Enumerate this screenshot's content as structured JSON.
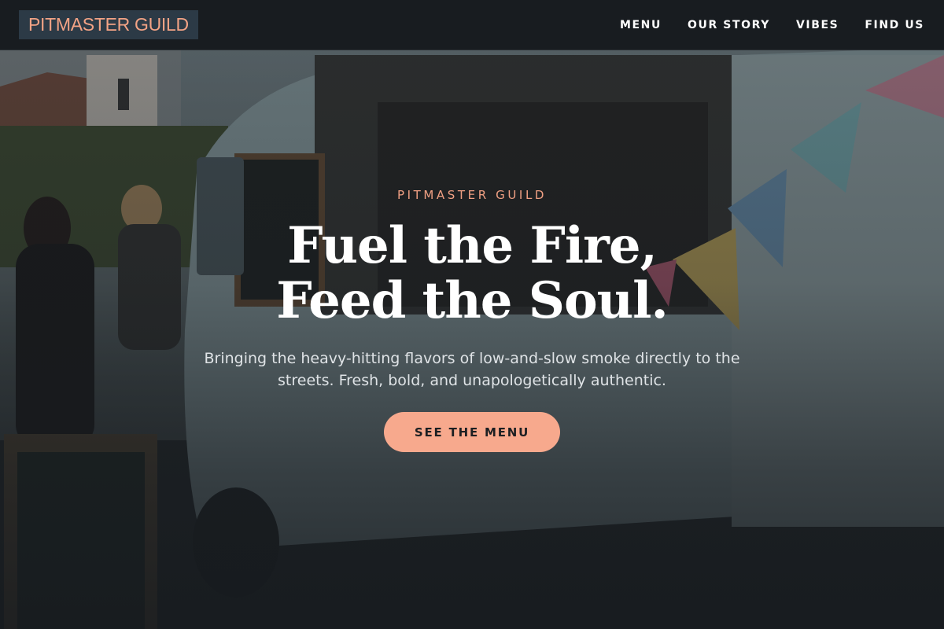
{
  "header": {
    "logo": "PITMASTER GUILD",
    "nav": [
      {
        "label": "MENU"
      },
      {
        "label": "OUR STORY"
      },
      {
        "label": "VIBES"
      },
      {
        "label": "FIND US"
      }
    ]
  },
  "hero": {
    "eyebrow": "PITMASTER GUILD",
    "headline_line1": "Fuel the Fire,",
    "headline_line2": "Feed the Soul.",
    "subtext": "Bringing the heavy-hitting flavors of low-and-slow smoke directly to the streets. Fresh, bold, and unapologetically authentic.",
    "cta_label": "SEE THE MENU"
  },
  "colors": {
    "accent": "#f7a98d",
    "logo_text": "#f3a385",
    "logo_bg": "#2c3a46",
    "header_bg": "#181c20"
  }
}
